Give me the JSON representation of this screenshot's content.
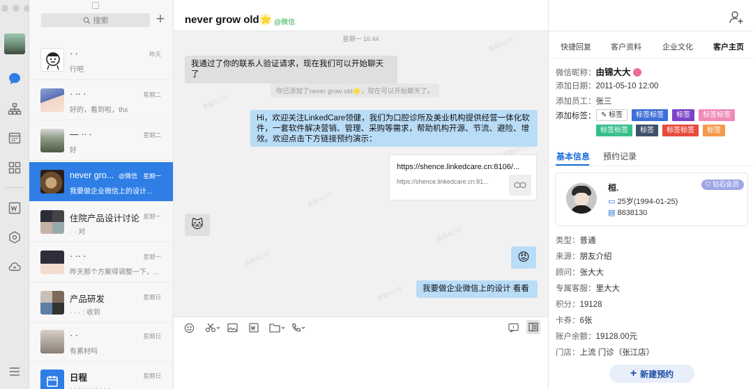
{
  "rail": {
    "icons": [
      "chat-icon",
      "org-icon",
      "calendar-icon",
      "apps-icon",
      "doc-icon",
      "cube-icon",
      "cloud-icon",
      "menu-icon"
    ]
  },
  "search": {
    "placeholder": "搜索"
  },
  "conversations": [
    {
      "name": "· ·",
      "time": "昨天",
      "msg": "行吧",
      "avatar": "cartoon"
    },
    {
      "name": "· ·· ·",
      "time": "星期二",
      "msg": "好的，看到啦，thx",
      "avatar": "anime"
    },
    {
      "name": "— ·· ·",
      "time": "星期二",
      "msg": "好",
      "avatar": "landscape"
    },
    {
      "name": "never gro...",
      "tag": "@微信",
      "time": "星期一",
      "msg": "我要做企业微信上的设计...",
      "avatar": "cat",
      "active": true
    },
    {
      "name": "住院产品设计讨论",
      "time": "星期一",
      "msg": "· · 对",
      "avatar": "group"
    },
    {
      "name": "· ·· ·",
      "time": "星期一",
      "msg": "昨天那个方案得调整一下，...",
      "avatar": "girl"
    },
    {
      "name": "产品研发",
      "time": "星期日",
      "msg": "· · · : 收到",
      "avatar": "group2"
    },
    {
      "name": "· ·",
      "time": "星期日",
      "msg": "有素材吗",
      "avatar": "person"
    },
    {
      "name": "日程",
      "time": "星期日",
      "msg": "· · · · · · · · · ·",
      "avatar": "calendar"
    }
  ],
  "chat": {
    "title": "never grow old",
    "title_emoji": "🌟",
    "wx_tag": "@微信",
    "timestamp": "星期一 16:44",
    "msg_verify": "我通过了你的联系人验证请求，现在我们可以开始聊天了",
    "sys_notice": "你已添加了never grow old🌟，现在可以开始聊天了。",
    "msg_welcome": "Hi，欢迎关注LinkedCare领健，我们为口腔诊所及美业机构提供经营一体化软件，一套软件解决营销、管理、采购等需求，帮助机构开源、节流、避险、增效。欢迎点击下方链接预约演示：",
    "link_title": "https://shence.linkedcare.cn:8106/...",
    "link_sub": "https://shence.linkedcare.cn:81...",
    "emoji_left": "🐱",
    "emoji_right": "😡",
    "msg_last": "我要做企业微信上的设计  看看",
    "watermark": "袁聪4179"
  },
  "panel": {
    "tabs": [
      "快捷回复",
      "客户资料",
      "企业文化",
      "客户主页"
    ],
    "active_tab": "客户主页",
    "nick_label": "微信昵称：",
    "nick": "由锦大大",
    "date_label": "添加日期：",
    "date": "2011-05-10  12:00",
    "staff_label": "添加员工：",
    "staff": "张三",
    "tag_label": "添加标签：",
    "tag_add": "标签",
    "tags": [
      {
        "text": "标签标签",
        "color": "#3c6fd9"
      },
      {
        "text": "标签",
        "color": "#7b43c8"
      },
      {
        "text": "标签标签",
        "color": "#f08ab6"
      },
      {
        "text": "标签标签",
        "color": "#36bf8c"
      },
      {
        "text": "标签",
        "color": "#3f5068"
      },
      {
        "text": "标签标签",
        "color": "#e74c3c"
      },
      {
        "text": "标签",
        "color": "#f39a4c"
      }
    ],
    "subtabs": [
      "基本信息",
      "预约记录"
    ],
    "card": {
      "name": "桓.",
      "age": "25岁(1994-01-25)",
      "id": "8638130",
      "vip": "钻石会员"
    },
    "info": [
      {
        "k": "类型：",
        "v": "普通"
      },
      {
        "k": "来源：",
        "v": "朋友介绍"
      },
      {
        "k": "顾问：",
        "v": "张大大"
      },
      {
        "k": "专属客服：",
        "v": "里大大"
      },
      {
        "k": "积分：",
        "v": "19128"
      },
      {
        "k": "卡券：",
        "v": "6张"
      },
      {
        "k": "账户余额：",
        "v": "19128.00元"
      },
      {
        "k": "门店：",
        "v": "上流      门诊（张江店）"
      }
    ],
    "new_button": "新建预约"
  }
}
